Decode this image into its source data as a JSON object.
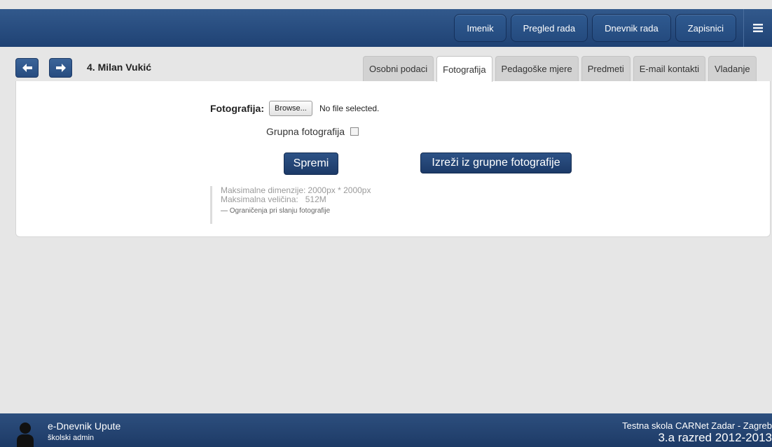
{
  "topnav": {
    "buttons": [
      "Imenik",
      "Pregled rada",
      "Dnevnik rada",
      "Zapisnici"
    ],
    "menu_icon": "hamburger-icon"
  },
  "header": {
    "student_name": "4. Milan Vukić",
    "back_icon": "arrow-left-icon",
    "forward_icon": "arrow-right-icon"
  },
  "tabs": [
    {
      "label": "Osobni podaci",
      "active": false
    },
    {
      "label": "Fotografija",
      "active": true
    },
    {
      "label": "Pedagoške mjere",
      "active": false
    },
    {
      "label": "Predmeti",
      "active": false
    },
    {
      "label": "E-mail kontakti",
      "active": false
    },
    {
      "label": "Vladanje",
      "active": false
    }
  ],
  "form": {
    "foto_label": "Fotografija:",
    "browse_label": "Browse...",
    "no_file": "No file selected.",
    "grupna_label": "Grupna fotografija",
    "grupna_checked": false,
    "save_label": "Spremi",
    "crop_label": "Izreži iz grupne fotografije"
  },
  "limits": {
    "dim_label": "Maksimalne dimenzije:",
    "dim_value": "2000px * 2000px",
    "size_label": "Maksimalna veličina:",
    "size_value": "512M",
    "note": "— Ograničenja pri slanju fotografije"
  },
  "footer": {
    "app_name": "e-Dnevnik Upute",
    "role": "školski admin",
    "school": "Testna skola CARNet Zadar - Zagreb",
    "class": "3.a razred 2012-2013"
  },
  "colors": {
    "primary": "#1f4274",
    "background": "#e6e6e6",
    "tab_inactive": "#d2d2d2"
  }
}
